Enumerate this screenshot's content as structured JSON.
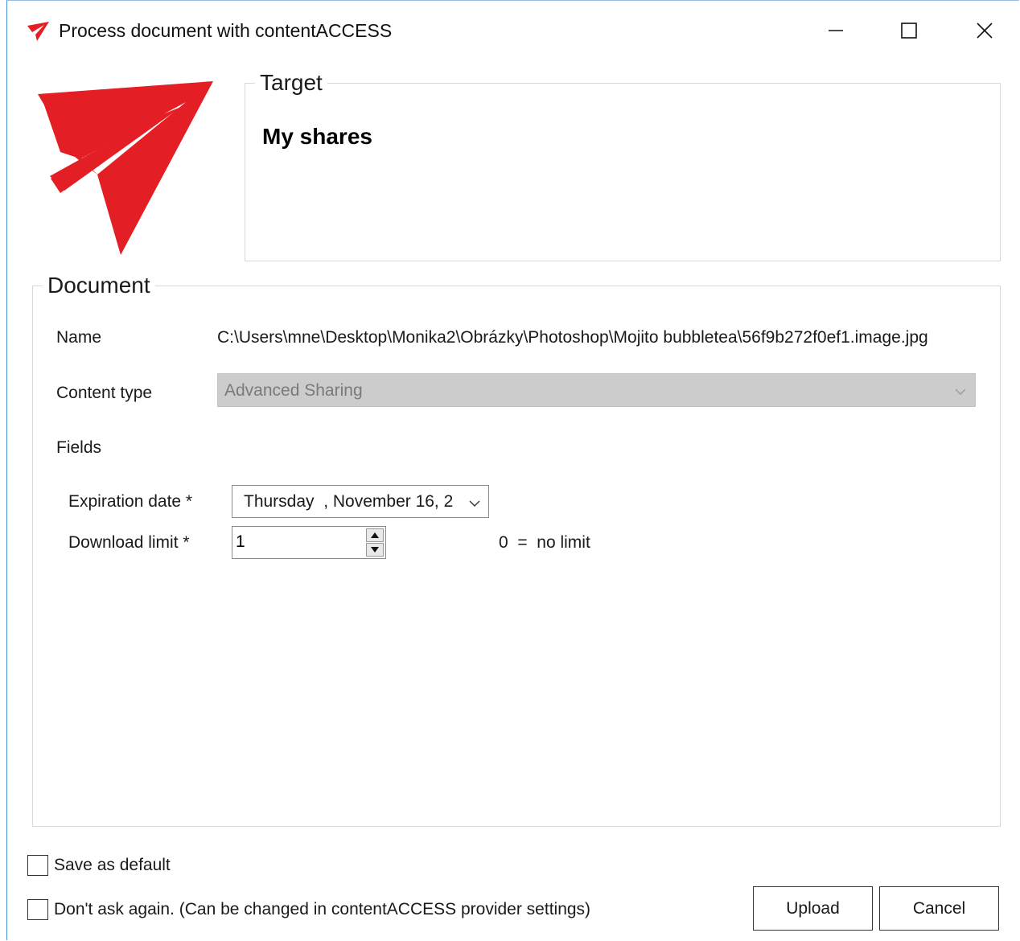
{
  "window": {
    "title": "Process document with contentACCESS",
    "app_icon": "contentaccess-logo-icon",
    "controls": [
      "minimize-icon",
      "maximize-icon",
      "close-icon"
    ]
  },
  "brand": {
    "logo": "contentaccess-logo",
    "color": "#e31e24"
  },
  "target": {
    "legend": "Target",
    "value": "My shares"
  },
  "document": {
    "legend": "Document",
    "name_label": "Name",
    "name_value": "C:\\Users\\mne\\Desktop\\Monika2\\Obrázky\\Photoshop\\Mojito bubbletea\\56f9b272f0ef1.image.jpg",
    "content_type_label": "Content type",
    "content_type_value": "Advanced Sharing",
    "fields_label": "Fields",
    "expiration_label": "Expiration date *",
    "expiration_value": "Thursday  , November 16, 2",
    "download_limit_label": "Download limit *",
    "download_limit_value": "1",
    "download_limit_hint": "0  =  no limit"
  },
  "options": {
    "save_default_label": "Save as default",
    "save_default_checked": false,
    "dont_ask_label": "Don't ask again. (Can be changed in contentACCESS provider settings)",
    "dont_ask_checked": false
  },
  "buttons": {
    "upload_label": "Upload",
    "cancel_label": "Cancel"
  }
}
